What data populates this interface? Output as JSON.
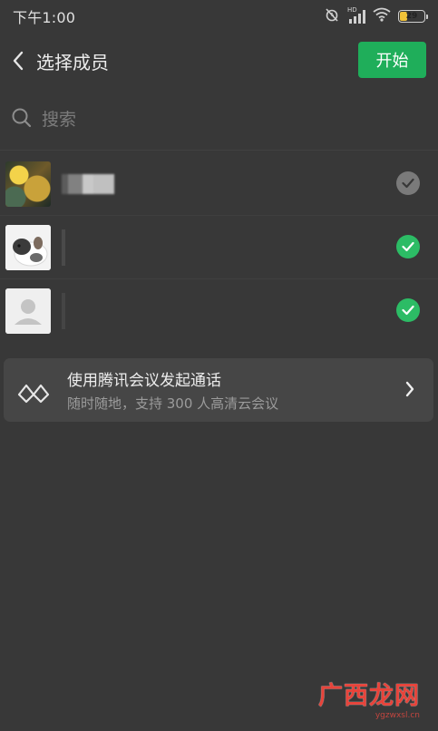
{
  "status_bar": {
    "time": "下午1:00",
    "network": "HD",
    "battery": "29",
    "battery_level": 0.29
  },
  "header": {
    "title": "选择成员",
    "start_label": "开始"
  },
  "search": {
    "placeholder": "搜索"
  },
  "members": [
    {
      "avatar": "artwork-avatar",
      "checked": false
    },
    {
      "avatar": "pet-avatar",
      "checked": true
    },
    {
      "avatar": "default-avatar",
      "checked": true
    }
  ],
  "meeting_card": {
    "title": "使用腾讯会议发起通话",
    "subtitle": "随时随地，支持 300 人高清云会议"
  },
  "colors": {
    "background": "#383838",
    "accent_green": "#1fae5a",
    "check_green": "#2cbc65",
    "card": "#464646"
  },
  "watermark": {
    "logo": "广西龙网",
    "url": "ygzwxsl.cn"
  }
}
